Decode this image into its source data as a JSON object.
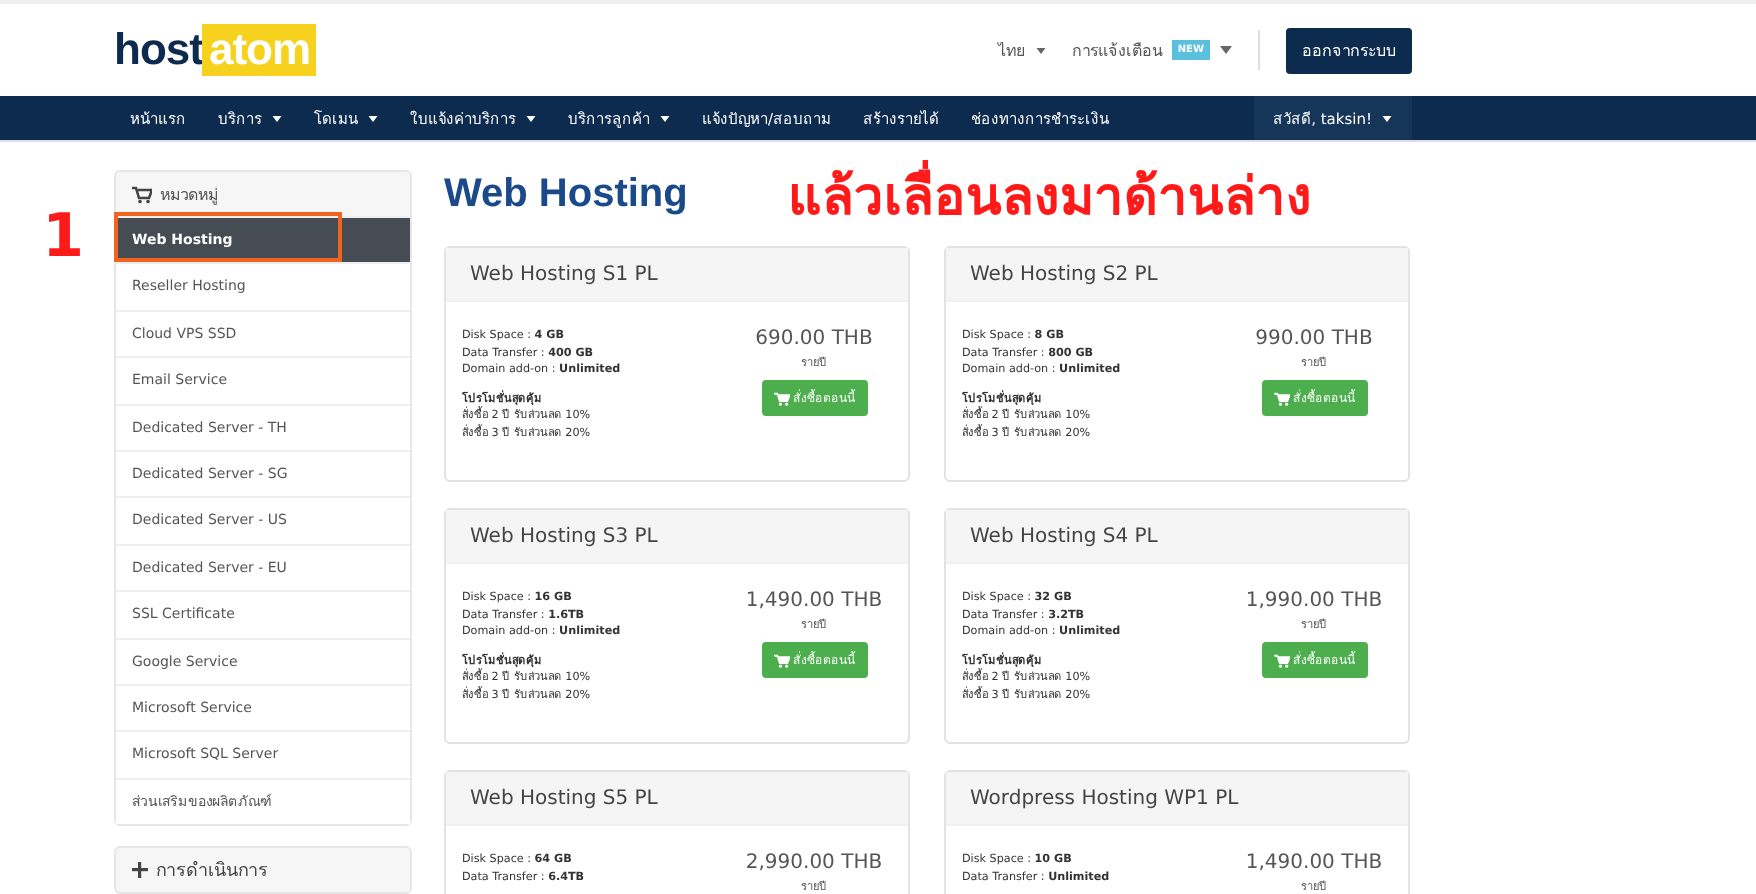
{
  "header": {
    "logo": {
      "part_1": "host",
      "part_2": "atom"
    },
    "language": "ไทย",
    "notifications": {
      "label": "การแจ้งเตือน",
      "badge": "NEW"
    },
    "logout_button": "ออกจากระบบ"
  },
  "nav": {
    "items": [
      {
        "label": "หน้าแรก",
        "dropdown": false
      },
      {
        "label": "บริการ",
        "dropdown": true
      },
      {
        "label": "โดเมน",
        "dropdown": true
      },
      {
        "label": "ใบแจ้งค่าบริการ",
        "dropdown": true
      },
      {
        "label": "บริการลูกค้า",
        "dropdown": true
      },
      {
        "label": "แจ้งปัญหา/สอบถาม",
        "dropdown": false
      },
      {
        "label": "สร้างรายได้",
        "dropdown": false
      },
      {
        "label": "ช่องทางการชำระเงิน",
        "dropdown": false
      }
    ],
    "user": "สวัสดี, taksin!"
  },
  "sidebar": {
    "title": "หมวดหมู่",
    "items": [
      {
        "label": "Web Hosting",
        "selected": true
      },
      {
        "label": "Reseller Hosting",
        "selected": false
      },
      {
        "label": "Cloud VPS SSD",
        "selected": false
      },
      {
        "label": "Email Service",
        "selected": false
      },
      {
        "label": "Dedicated Server - TH",
        "selected": false
      },
      {
        "label": "Dedicated Server - SG",
        "selected": false
      },
      {
        "label": "Dedicated Server - US",
        "selected": false
      },
      {
        "label": "Dedicated Server - EU",
        "selected": false
      },
      {
        "label": "SSL Certificate",
        "selected": false
      },
      {
        "label": "Google Service",
        "selected": false
      },
      {
        "label": "Microsoft Service",
        "selected": false
      },
      {
        "label": "Microsoft SQL Server",
        "selected": false
      },
      {
        "label": "ส่วนเสริมของผลิตภัณฑ์",
        "selected": false
      }
    ],
    "actions_title": "การดำเนินการ"
  },
  "page_title": "Web Hosting",
  "annotation": {
    "step": "1",
    "instruction": "แล้วเลื่อนลงมาด้านล่าง"
  },
  "products": [
    {
      "name": "Web Hosting S1 PL",
      "specs": [
        "Disk Space : **4 GB**",
        "Data Transfer : **400 GB**",
        "Domain add-on : **Unlimited**"
      ],
      "promo_title": "โปรโมชั่นสุดคุ้ม",
      "promo_lines": [
        "สั่งซื้อ 2 ปี รับส่วนลด 10%",
        "สั่งซื้อ 3 ปี รับส่วนลด 20%"
      ],
      "price": "690.00 THB",
      "period": "รายปี",
      "order_button": "สั่งซื้อตอนนี้"
    },
    {
      "name": "Web Hosting S2 PL",
      "specs": [
        "Disk Space : **8 GB**",
        "Data Transfer : **800 GB**",
        "Domain add-on : **Unlimited**"
      ],
      "promo_title": "โปรโมชั่นสุดคุ้ม",
      "promo_lines": [
        "สั่งซื้อ 2 ปี รับส่วนลด 10%",
        "สั่งซื้อ 3 ปี รับส่วนลด 20%"
      ],
      "price": "990.00 THB",
      "period": "รายปี",
      "order_button": "สั่งซื้อตอนนี้"
    },
    {
      "name": "Web Hosting S3 PL",
      "specs": [
        "Disk Space : **16 GB**",
        "Data Transfer : **1.6TB**",
        "Domain add-on : **Unlimited**"
      ],
      "promo_title": "โปรโมชั่นสุดคุ้ม",
      "promo_lines": [
        "สั่งซื้อ 2 ปี รับส่วนลด 10%",
        "สั่งซื้อ 3 ปี รับส่วนลด 20%"
      ],
      "price": "1,490.00 THB",
      "period": "รายปี",
      "order_button": "สั่งซื้อตอนนี้"
    },
    {
      "name": "Web Hosting S4 PL",
      "specs": [
        "Disk Space : **32 GB**",
        "Data Transfer : **3.2TB**",
        "Domain add-on : **Unlimited**"
      ],
      "promo_title": "โปรโมชั่นสุดคุ้ม",
      "promo_lines": [
        "สั่งซื้อ 2 ปี รับส่วนลด 10%",
        "สั่งซื้อ 3 ปี รับส่วนลด 20%"
      ],
      "price": "1,990.00 THB",
      "period": "รายปี",
      "order_button": "สั่งซื้อตอนนี้"
    },
    {
      "name": "Web Hosting S5 PL",
      "specs": [
        "Disk Space : **64 GB**",
        "Data Transfer : **6.4TB**"
      ],
      "price": "2,990.00 THB",
      "period": "รายปี"
    },
    {
      "name": "Wordpress Hosting WP1 PL",
      "specs": [
        "Disk Space : **10 GB**",
        "Data Transfer : **Unlimited**"
      ],
      "price": "1,490.00 THB",
      "period": "รายปี"
    }
  ]
}
